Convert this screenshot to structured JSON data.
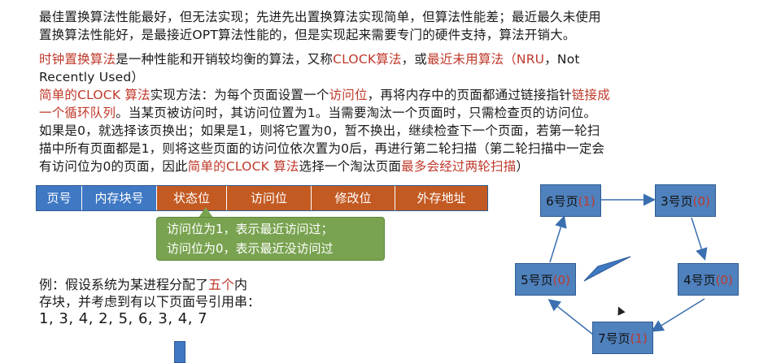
{
  "paragraphs": {
    "p1_line1": "最佳置换算法性能最好，但无法实现；先进先出置换算法实现简单，但算法性能差；最近最久未使用",
    "p1_line2": "置换算法性能好，是最接近OPT算法性能的，但是实现起来需要专门的硬件支持，算法开销大。",
    "p2_a": "时钟置换算法",
    "p2_b": "是一种性能和开销较均衡的算法，又称",
    "p2_c": "CLOCK算法",
    "p2_d": "，或",
    "p2_e": "最近未用算法",
    "p2_f": "（",
    "p2_g": "NRU",
    "p2_h": "，Not",
    "p2_line2": "Recently Used）",
    "p3_a": "简单的CLOCK 算法",
    "p3_b": "实现方法：为每个页面设置一个",
    "p3_c": "访问位",
    "p3_d": "，再将内存中的页面都通过链接指针",
    "p3_e": "链接成",
    "p3_line2_a": "一个循环队列",
    "p3_line2_b": "。当某页被访问时，其访问位置为1。当需要淘汰一个页面时，只需检查页的访问位。",
    "p3_line3": "如果是0，就选择该页换出；如果是1，则将它置为0，暂不换出，继续检查下一个页面，若第一轮扫",
    "p3_line4": "描中所有页面都是1，则将这些页面的访问位依次置为0后，再进行第二轮扫描（第二轮扫描中一定会",
    "p3_line5_a": "有访问位为0的页面，因此",
    "p3_line5_b": "简单的CLOCK 算法",
    "p3_line5_c": "选择一个淘汰页面",
    "p3_line5_d": "最多会经过两轮扫描",
    "p3_line5_e": "）"
  },
  "page_table": {
    "columns": [
      "页号",
      "内存块号",
      "状态位",
      "访问位",
      "修改位",
      "外存地址"
    ]
  },
  "callout": {
    "line1": "访问位为1，表示最近访问过；",
    "line2": "访问位为0，表示最近没访问过"
  },
  "example": {
    "line1_a": "例：假设系统为某进程分配了",
    "line1_b": "五个",
    "line1_c": "内",
    "line2": "存块，并考虑到有以下页面号引用串：",
    "reference_string": "1, 3, 4, 2, 5, 6, 3, 4, 7"
  },
  "clock_nodes": [
    {
      "page": "6号页",
      "bit": "(1)"
    },
    {
      "page": "3号页",
      "bit": "(0)"
    },
    {
      "page": "4号页",
      "bit": "(0)"
    },
    {
      "page": "7号页",
      "bit": "(1)"
    },
    {
      "page": "5号页",
      "bit": "(0)"
    }
  ],
  "colors": {
    "text_red": "#c0392b",
    "table_blue": "#3f78c3",
    "table_orange": "#c35a22",
    "callout_green": "#79a350",
    "node_blue": "#4f81bd"
  }
}
